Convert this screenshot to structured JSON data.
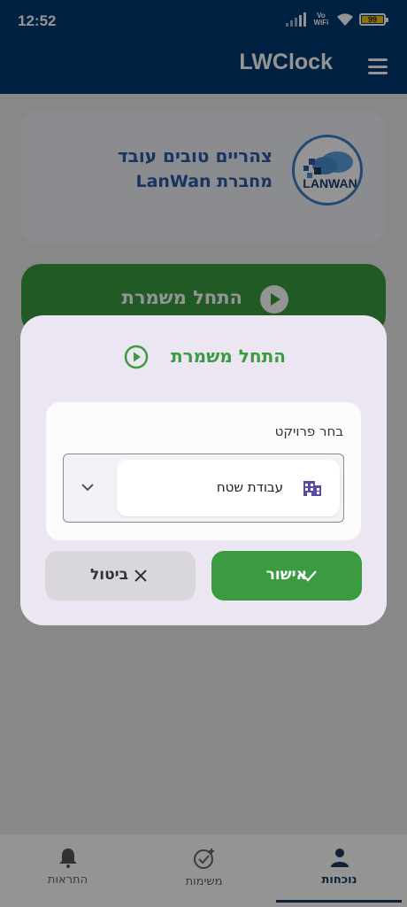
{
  "status_bar": {
    "time": "12:52",
    "network_label": "Vo WiFi",
    "battery": "99"
  },
  "app_bar": {
    "title": "LWClock"
  },
  "company_card": {
    "greeting": "צהריים טובים עובד",
    "company": "מחברת LanWan",
    "logo_text": "LANWAN"
  },
  "start_shift_button": {
    "label": "התחל משמרת"
  },
  "dialog": {
    "title": "התחל משמרת",
    "field_label": "בחר פרויקט",
    "selected_project": "עבודת שטח",
    "confirm_label": "אישור",
    "cancel_label": "ביטול"
  },
  "bottom_nav": {
    "items": [
      {
        "label": "נוכחות",
        "icon": "person-icon",
        "active": true
      },
      {
        "label": "משימות",
        "icon": "task-add-icon",
        "active": false
      },
      {
        "label": "התראות",
        "icon": "bell-icon",
        "active": false
      }
    ]
  },
  "colors": {
    "primary": "#003a70",
    "accent_green": "#3a9b40",
    "dialog_bg": "#ece6f2"
  }
}
